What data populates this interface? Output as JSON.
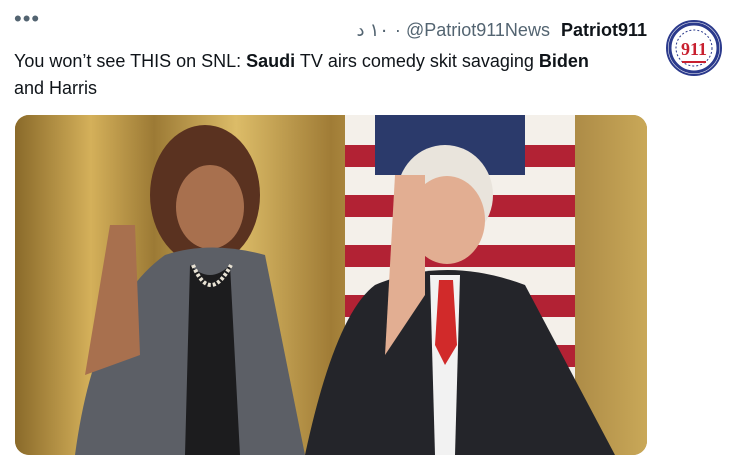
{
  "tweet": {
    "more_icon": "more-horizontal-icon",
    "display_name": "Patriot911",
    "handle": "@Patriot911News",
    "timestamp": "١٠ د",
    "text_parts": [
      {
        "text": "You won’t see THIS on SNL: ",
        "bold": false
      },
      {
        "text": "Saudi",
        "bold": true
      },
      {
        "text": " TV airs comedy skit savaging ",
        "bold": false
      },
      {
        "text": "Biden",
        "bold": true
      },
      {
        "text": " and Harris",
        "bold": false
      }
    ],
    "avatar_logo_text": "911",
    "media": {
      "kind": "video-still",
      "description_icon": "video-thumbnail"
    }
  },
  "colors": {
    "text": "#0f1419",
    "muted": "#536471",
    "avatar_ring": "#2b3a8c",
    "avatar_red": "#c8202f"
  }
}
